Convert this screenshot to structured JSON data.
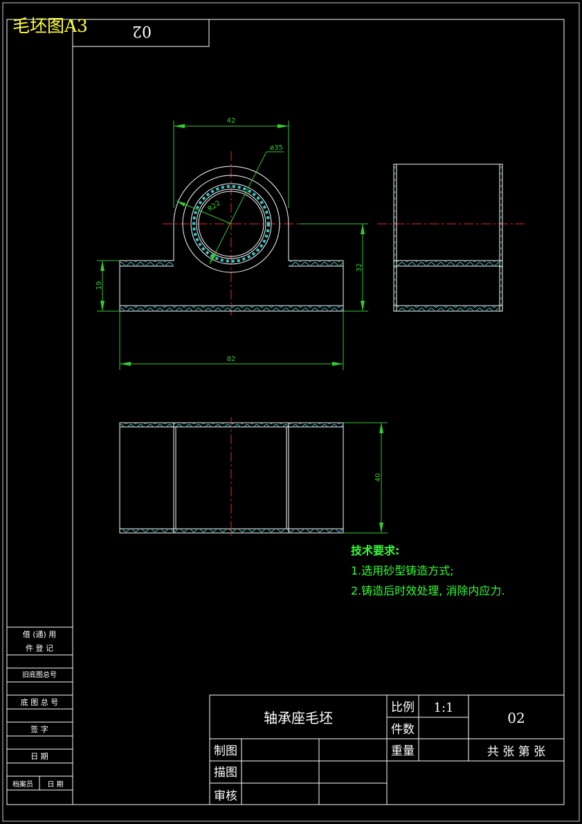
{
  "sheet_title": "毛坯图A3",
  "drawing_number_flipped": "02",
  "dimensions": {
    "top_width": "42",
    "outer_diameter": "ø35",
    "inner_radius": "R22",
    "base_height": "19",
    "total_height": "32",
    "base_width": "82",
    "depth": "40"
  },
  "technical_requirements": {
    "heading": "技术要求:",
    "items": [
      "1.选用砂型铸造方式;",
      "2.铸造后时效处理, 消除内应力."
    ]
  },
  "side_stamp": {
    "row1": "借 (通) 用",
    "row2": "件  登  记",
    "old_base_total": "旧底图总号",
    "base_total": "底 图 总 号",
    "signature": "签    字",
    "date": "日    期",
    "archivist": "档案员",
    "archivist_date": "日  期"
  },
  "title_block": {
    "part_name": "轴承座毛坯",
    "scale_label": "比例",
    "scale_value": "1:1",
    "quantity_label": "件数",
    "weight_label": "重量",
    "drawing_number": "02",
    "sheet_count": "共 张 第 张",
    "drawn_label": "制图",
    "traced_label": "描图",
    "checked_label": "审核"
  },
  "colors": {
    "background": "#000000",
    "outline": "#ffffff",
    "dimension": "#33cc33",
    "centerline": "#ff2020",
    "hatch": "#33cccc",
    "title_accent": "#ffff33",
    "tech_text": "#33ff33"
  }
}
